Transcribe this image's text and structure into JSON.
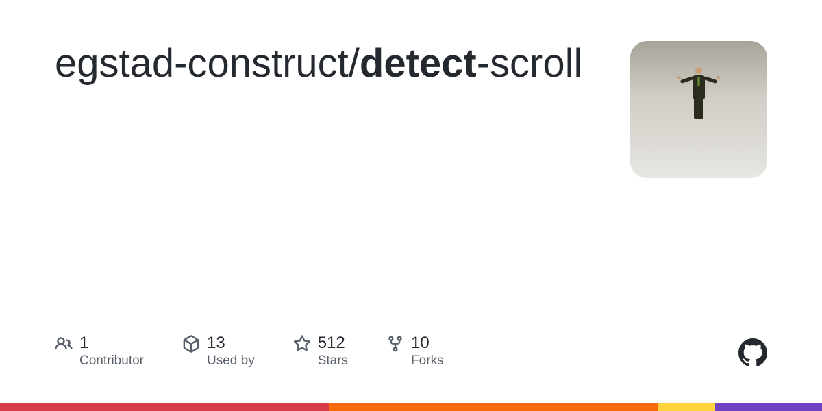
{
  "repo": {
    "owner": "egstad-construct",
    "separator": "/",
    "name_bold": "detect",
    "name_rest": "-scroll"
  },
  "stats": [
    {
      "icon": "people-icon",
      "count": "1",
      "label": "Contributor"
    },
    {
      "icon": "package-icon",
      "count": "13",
      "label": "Used by"
    },
    {
      "icon": "star-icon",
      "count": "512",
      "label": "Stars"
    },
    {
      "icon": "fork-icon",
      "count": "10",
      "label": "Forks"
    }
  ],
  "colors": {
    "text_primary": "#24292f",
    "text_muted": "#57606a",
    "bar": [
      "#d73a49",
      "#f66a0a",
      "#ffd33d",
      "#6f42c1"
    ]
  }
}
